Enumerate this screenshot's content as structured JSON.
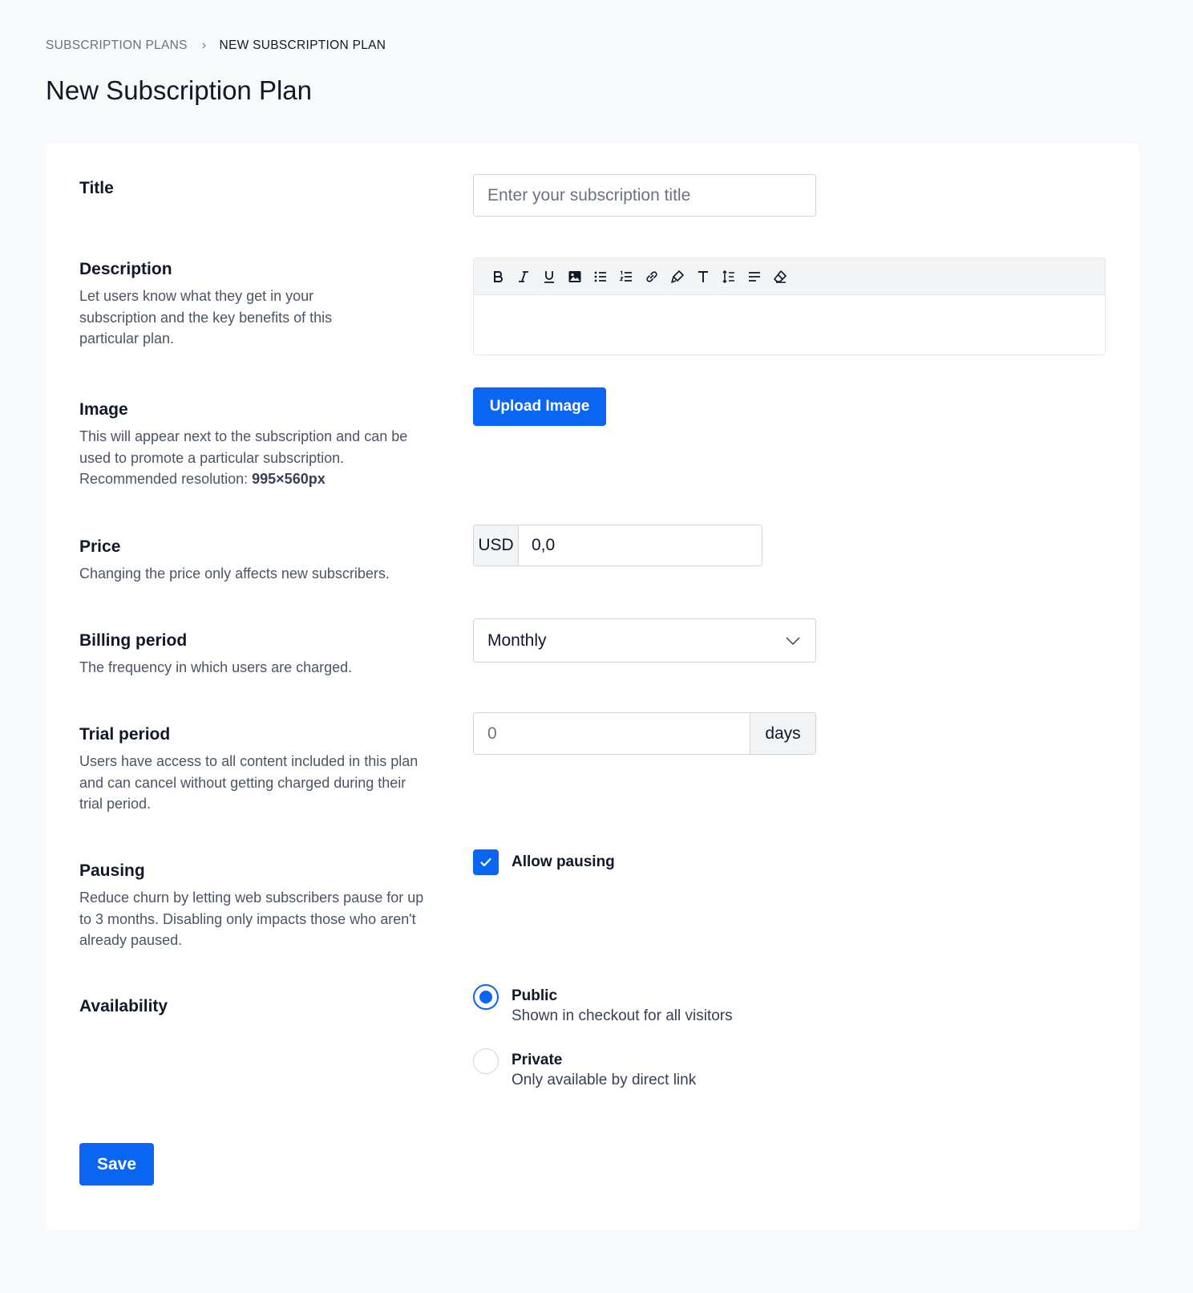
{
  "breadcrumb": {
    "parent": "SUBSCRIPTION PLANS",
    "separator": "›",
    "current": "NEW SUBSCRIPTION PLAN"
  },
  "page_title": "New Subscription Plan",
  "form": {
    "title": {
      "label": "Title",
      "placeholder": "Enter your subscription title",
      "value": ""
    },
    "description": {
      "label": "Description",
      "help": "Let users know what they get in your subscription and the key benefits of this particular plan.",
      "toolbar": [
        "bold-icon",
        "italic-icon",
        "underline-icon",
        "image-icon",
        "bullet-list-icon",
        "numbered-list-icon",
        "link-icon",
        "highlighter-icon",
        "text-size-icon",
        "line-height-icon",
        "align-icon",
        "eraser-icon"
      ]
    },
    "image": {
      "label": "Image",
      "help": "This will appear next to the subscription and can be used to promote a particular subscription.",
      "resolution_label": "Recommended resolution:",
      "resolution_value": "995×560px",
      "button_label": "Upload Image"
    },
    "price": {
      "label": "Price",
      "help": "Changing the price only affects new subscribers.",
      "currency": "USD",
      "value": "0,0"
    },
    "billing_period": {
      "label": "Billing period",
      "help": "The frequency in which users are charged.",
      "selected": "Monthly"
    },
    "trial_period": {
      "label": "Trial period",
      "help": "Users have access to all content included in this plan and can cancel without getting charged during their trial period.",
      "placeholder": "0",
      "suffix": "days"
    },
    "pausing": {
      "label": "Pausing",
      "help": "Reduce churn by letting web subscribers pause for up to 3 months. Disabling only impacts those who aren't already paused.",
      "checkbox_label": "Allow pausing",
      "checked": true
    },
    "availability": {
      "label": "Availability",
      "options": [
        {
          "title": "Public",
          "description": "Shown in checkout for all visitors",
          "selected": true
        },
        {
          "title": "Private",
          "description": "Only available by direct link",
          "selected": false
        }
      ]
    },
    "save_label": "Save"
  },
  "colors": {
    "accent": "#0a66f2",
    "background": "#f8f9fb",
    "card": "#ffffff"
  }
}
